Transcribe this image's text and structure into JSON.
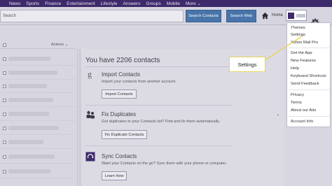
{
  "topnav": {
    "items": [
      "News",
      "Sports",
      "Finance",
      "Entertainment",
      "Lifestyle",
      "Answers",
      "Groups",
      "Mobile",
      "More ⌄"
    ]
  },
  "search": {
    "placeholder": "Search",
    "search_contacts_label": "Search Contacts",
    "search_web_label": "Search Web"
  },
  "header": {
    "home_label": "Home"
  },
  "list": {
    "actions_label": "Actions ⌄"
  },
  "main": {
    "title": "You have 2206 contacts",
    "sections": [
      {
        "title": "Import Contacts",
        "desc": "Import your contacts from another account.",
        "button": "Import Contacts",
        "icon": "google-icon"
      },
      {
        "title": "Fix Duplicates",
        "desc": "Got duplicates in your Contacts list? Find and fix them automatically.",
        "button": "Fix Duplicate Contacts",
        "icon": "people-icon"
      },
      {
        "title": "Sync Contacts",
        "desc": "Want your Contacts on the go? Sync them with your phone or computer.",
        "button": "Learn How",
        "icon": "sync-icon"
      }
    ]
  },
  "dropdown": {
    "items": [
      "Themes",
      "Settings",
      "Yahoo Mail Pro",
      "Get the App",
      "New Features",
      "Help",
      "Keyboard Shortcuts",
      "Send Feedback",
      "Privacy",
      "Terms",
      "About our Ads",
      "Account Info"
    ]
  },
  "callout": {
    "label": "Settings"
  },
  "colors": {
    "nav_bg": "#3d2a6b",
    "button_blue": "#4874a9",
    "callout_border": "#e7d55c"
  }
}
